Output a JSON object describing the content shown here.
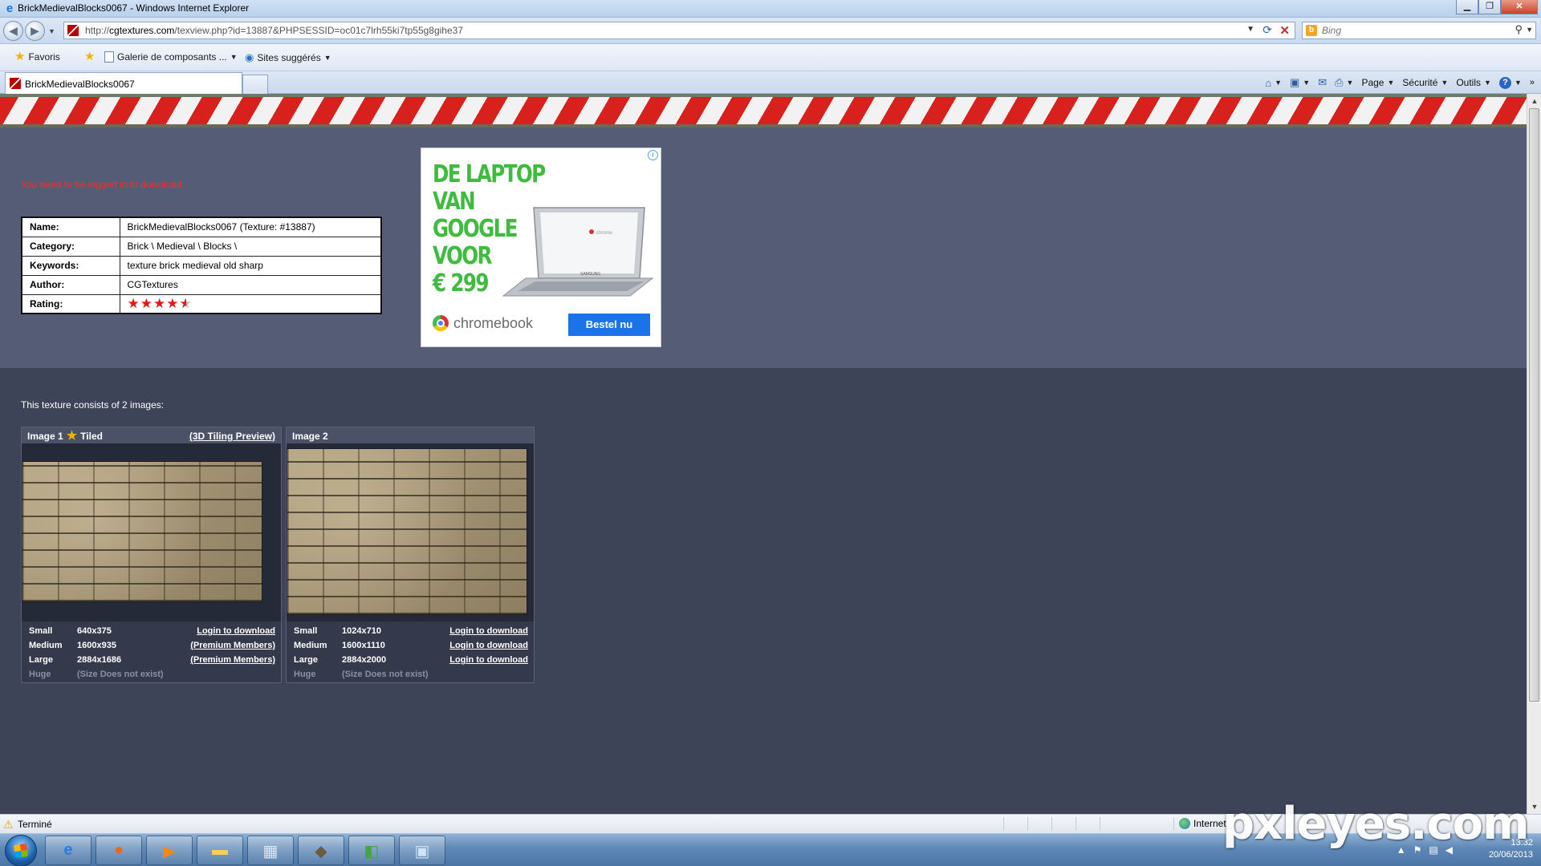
{
  "window": {
    "title": "BrickMedievalBlocks0067 - Windows Internet Explorer"
  },
  "address": {
    "url_prefix": "http://",
    "url_domain": "cgtextures.com",
    "url_path": "/texview.php?id=13887&PHPSESSID=oc01c7lrh55ki7tp55g8gihe37",
    "search_placeholder": "Bing"
  },
  "favorites": {
    "favoris": "Favoris",
    "galerie": "Galerie de composants ...",
    "sites": "Sites suggérés"
  },
  "tab": {
    "label": "BrickMedievalBlocks0067"
  },
  "commands": {
    "page": "Page",
    "securite": "Sécurité",
    "outils": "Outils"
  },
  "page": {
    "login_notice": "You need to be logged in to download.",
    "info": [
      {
        "key": "Name:",
        "value": "BrickMedievalBlocks0067 (Texture: #13887)"
      },
      {
        "key": "Category:",
        "value": "Brick \\ Medieval \\ Blocks \\"
      },
      {
        "key": "Keywords:",
        "value": "texture brick medieval old sharp"
      },
      {
        "key": "Author:",
        "value": "CGTextures"
      },
      {
        "key": "Rating:",
        "value": ""
      }
    ],
    "rating": 4.5,
    "consists": "This texture consists of 2 images:",
    "images": [
      {
        "title": "Image 1",
        "tiled": "Tiled",
        "preview_link": "(3D Tiling Preview)",
        "sizes": [
          {
            "name": "Small",
            "res": "640x375",
            "link": "Login to download"
          },
          {
            "name": "Medium",
            "res": "1600x935",
            "link": "(Premium Members)"
          },
          {
            "name": "Large",
            "res": "2884x1686",
            "link": "(Premium Members)"
          },
          {
            "name": "Huge",
            "res": "(Size Does not exist)",
            "link": ""
          }
        ]
      },
      {
        "title": "Image 2",
        "sizes": [
          {
            "name": "Small",
            "res": "1024x710",
            "link": "Login to download"
          },
          {
            "name": "Medium",
            "res": "1600x1110",
            "link": "Login to download"
          },
          {
            "name": "Large",
            "res": "2884x2000",
            "link": "Login to download"
          },
          {
            "name": "Huge",
            "res": "(Size Does not exist)",
            "link": ""
          }
        ]
      }
    ]
  },
  "ad": {
    "headline": "DE LAPTOP\nVAN GOOGLE\nVOOR\n€ 299",
    "brand": "chromebook",
    "cta": "Bestel nu",
    "laptop_brand": "SAMSUNG",
    "screen_text": "chrome"
  },
  "status": {
    "text": "Terminé",
    "zone": "Internet"
  },
  "tray": {
    "time": "13:32",
    "date": "20/06/2013"
  },
  "watermark": "pxleyes.com"
}
